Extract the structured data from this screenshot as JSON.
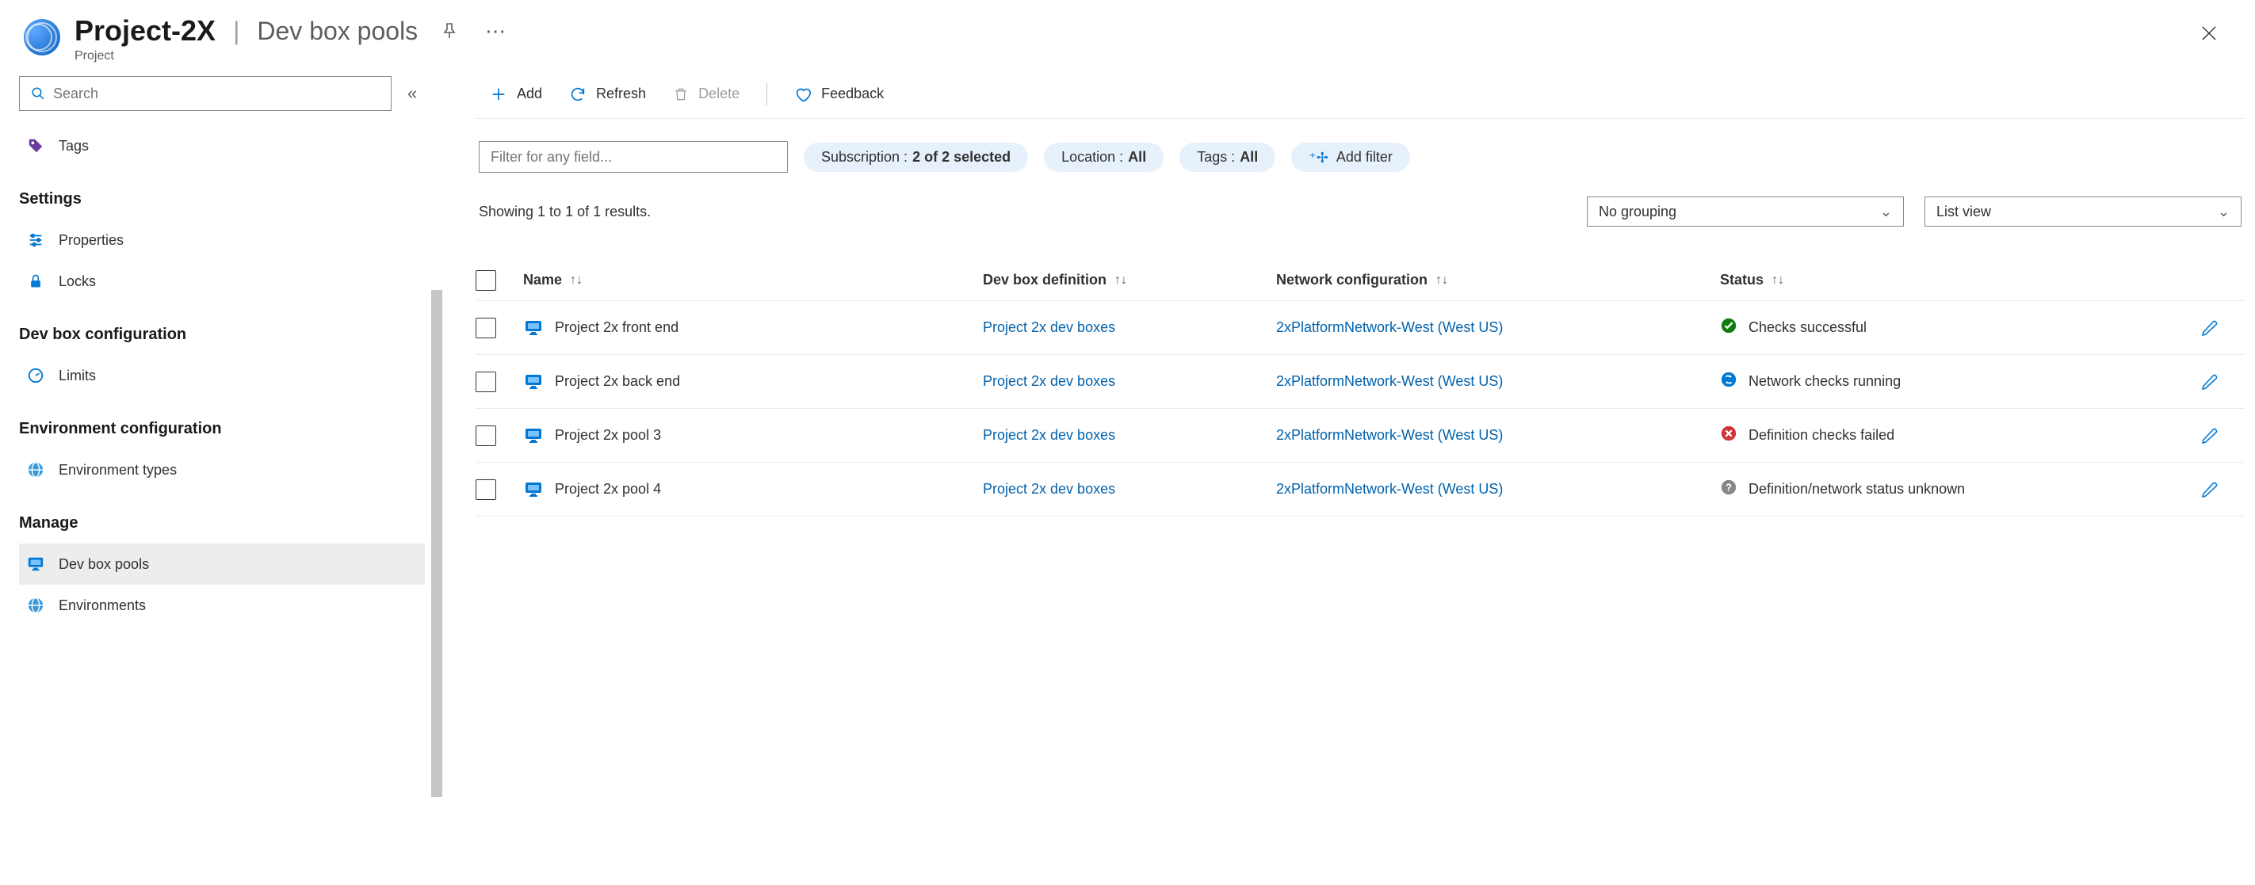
{
  "header": {
    "title": "Project-2X",
    "section": "Dev box pools",
    "subtitle": "Project"
  },
  "sidebar": {
    "search_placeholder": "Search",
    "top_items": [
      {
        "id": "tags",
        "label": "Tags"
      }
    ],
    "sections": [
      {
        "title": "Settings",
        "items": [
          {
            "id": "properties",
            "label": "Properties"
          },
          {
            "id": "locks",
            "label": "Locks"
          }
        ]
      },
      {
        "title": "Dev box configuration",
        "items": [
          {
            "id": "limits",
            "label": "Limits"
          }
        ]
      },
      {
        "title": "Environment configuration",
        "items": [
          {
            "id": "environment-types",
            "label": "Environment types"
          }
        ]
      },
      {
        "title": "Manage",
        "items": [
          {
            "id": "dev-box-pools",
            "label": "Dev box pools",
            "selected": true
          },
          {
            "id": "environments",
            "label": "Environments"
          }
        ]
      }
    ]
  },
  "toolbar": {
    "add": "Add",
    "refresh": "Refresh",
    "delete": "Delete",
    "feedback": "Feedback"
  },
  "filters": {
    "filter_placeholder": "Filter for any field...",
    "subscription_label": "Subscription :",
    "subscription_value": "2 of 2 selected",
    "location_label": "Location :",
    "location_value": "All",
    "tags_label": "Tags :",
    "tags_value": "All",
    "add_filter": "Add filter"
  },
  "results": {
    "text": "Showing 1 to 1 of 1 results.",
    "grouping": "No grouping",
    "view": "List view"
  },
  "table": {
    "columns": {
      "name": "Name",
      "definition": "Dev box definition",
      "network": "Network configuration",
      "status": "Status"
    },
    "rows": [
      {
        "name": "Project 2x front end",
        "definition": "Project 2x dev boxes",
        "network": "2xPlatformNetwork-West (West US)",
        "status_icon": "success",
        "status_text": "Checks successful"
      },
      {
        "name": "Project 2x back end",
        "definition": "Project 2x dev boxes",
        "network": "2xPlatformNetwork-West (West US)",
        "status_icon": "running",
        "status_text": "Network checks running"
      },
      {
        "name": "Project 2x pool 3",
        "definition": "Project 2x dev boxes",
        "network": "2xPlatformNetwork-West (West US)",
        "status_icon": "failed",
        "status_text": "Definition checks failed"
      },
      {
        "name": "Project 2x pool 4",
        "definition": "Project 2x dev boxes",
        "network": "2xPlatformNetwork-West (West US)",
        "status_icon": "unknown",
        "status_text": "Definition/network status unknown"
      }
    ]
  }
}
